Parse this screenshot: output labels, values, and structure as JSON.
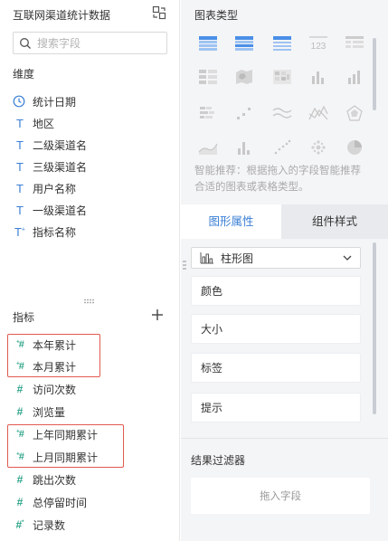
{
  "datasource": {
    "title": "互联网渠道统计数据",
    "switch_icon": "swap-icon"
  },
  "search": {
    "placeholder": "搜索字段",
    "value": ""
  },
  "dimensions": {
    "label": "维度",
    "items": [
      {
        "icon": "clock-icon",
        "label": "统计日期"
      },
      {
        "icon": "text-T-icon",
        "label": "地区"
      },
      {
        "icon": "text-T-icon",
        "label": "二级渠道名"
      },
      {
        "icon": "text-T-icon",
        "label": "三级渠道名"
      },
      {
        "icon": "text-T-icon",
        "label": "用户名称"
      },
      {
        "icon": "text-T-icon",
        "label": "一级渠道名"
      },
      {
        "icon": "text-T-calc-icon",
        "label": "指标名称"
      }
    ]
  },
  "measures": {
    "label": "指标",
    "add_icon": "plus-icon",
    "items": [
      {
        "icon": "calc-hash-icon",
        "label": "本年累计",
        "highlighted": true
      },
      {
        "icon": "calc-hash-icon",
        "label": "本月累计",
        "highlighted": true
      },
      {
        "icon": "hash-icon",
        "label": "访问次数"
      },
      {
        "icon": "hash-icon",
        "label": "浏览量"
      },
      {
        "icon": "calc-hash-icon",
        "label": "上年同期累计",
        "highlighted": true
      },
      {
        "icon": "calc-hash-icon",
        "label": "上月同期累计",
        "highlighted": true
      },
      {
        "icon": "hash-icon",
        "label": "跳出次数"
      },
      {
        "icon": "hash-icon",
        "label": "总停留时间"
      },
      {
        "icon": "hash-star-icon",
        "label": "记录数"
      }
    ]
  },
  "chart_types": {
    "title": "图表类型",
    "icons": [
      "table-icon",
      "crosstab-icon",
      "detail-table-icon",
      "kpi-number-icon",
      "grouped-table-icon",
      "split-table-icon",
      "map-icon",
      "heatmap-icon",
      "bar-chart-icon",
      "column-chart-icon",
      "stacked-bar-icon",
      "scatter-step-icon",
      "line-chart-icon",
      "radar-fold-icon",
      "radar-icon",
      "area-chart-icon",
      "histogram-icon",
      "scatter-icon",
      "dot-cluster-icon",
      "pie-chart-icon"
    ],
    "smart_hint": "智能推荐：根据拖入的字段智能推荐合适的图表或表格类型。"
  },
  "tabs": [
    {
      "label": "图形属性",
      "active": true
    },
    {
      "label": "组件样式",
      "active": false
    }
  ],
  "graph_props": {
    "chart_select": {
      "icon": "bar-chart-icon",
      "value": "柱形图"
    },
    "rows": [
      "颜色",
      "大小",
      "标签",
      "提示"
    ]
  },
  "result_filter": {
    "title": "结果过滤器",
    "drop_hint": "拖入字段"
  },
  "colors": {
    "accent": "#3a7fd5",
    "highlight_box": "#e05a4e",
    "measure_icon": "#2fa58a",
    "panel_bg": "#f4f5f7"
  }
}
